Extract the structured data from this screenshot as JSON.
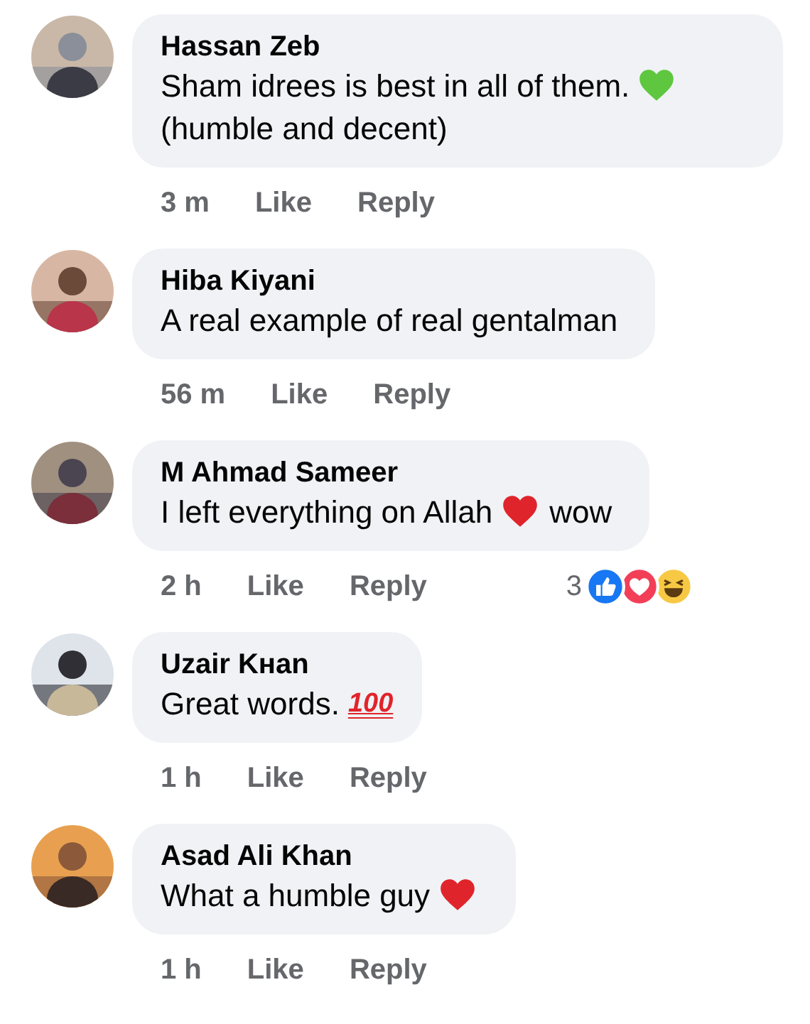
{
  "comments": [
    {
      "author": "Hassan Zeb",
      "avatar": {
        "kind": "picture"
      },
      "body": [
        {
          "kind": "text",
          "text": "Sham idrees is best in all of them."
        },
        {
          "kind": "heart",
          "color": "#5ec73f"
        },
        {
          "kind": "text",
          "text": "(humble and decent)"
        }
      ],
      "time": "3 m",
      "like": "Like",
      "reply": "Reply"
    },
    {
      "author": "Hiba Kiyani",
      "avatar": {
        "kind": "picture"
      },
      "body": [
        {
          "kind": "text",
          "text": "A real example of real gentalman"
        }
      ],
      "time": "56 m",
      "like": "Like",
      "reply": "Reply"
    },
    {
      "author": "M Ahmad Sameer",
      "avatar": {
        "kind": "picture"
      },
      "body": [
        {
          "kind": "text",
          "text": "I left everything on Allah"
        },
        {
          "kind": "heart",
          "color": "#e0242b"
        },
        {
          "kind": "text",
          "text": "wow"
        }
      ],
      "time": "2 h",
      "like": "Like",
      "reply": "Reply",
      "reactions": {
        "count": "3",
        "icons": [
          {
            "kind": "like"
          },
          {
            "kind": "love"
          },
          {
            "kind": "haha"
          }
        ]
      }
    },
    {
      "author": "Uzair Kнan",
      "avatar": {
        "kind": "picture"
      },
      "body": [
        {
          "kind": "text",
          "text": "Great words."
        },
        {
          "kind": "hundred",
          "text": "100"
        }
      ],
      "time": "1 h",
      "like": "Like",
      "reply": "Reply"
    },
    {
      "author": "Asad Ali Khan",
      "avatar": {
        "kind": "picture"
      },
      "body": [
        {
          "kind": "text",
          "text": "What a humble guy"
        },
        {
          "kind": "heart",
          "color": "#e0242b"
        }
      ],
      "time": "1 h",
      "like": "Like",
      "reply": "Reply"
    }
  ]
}
